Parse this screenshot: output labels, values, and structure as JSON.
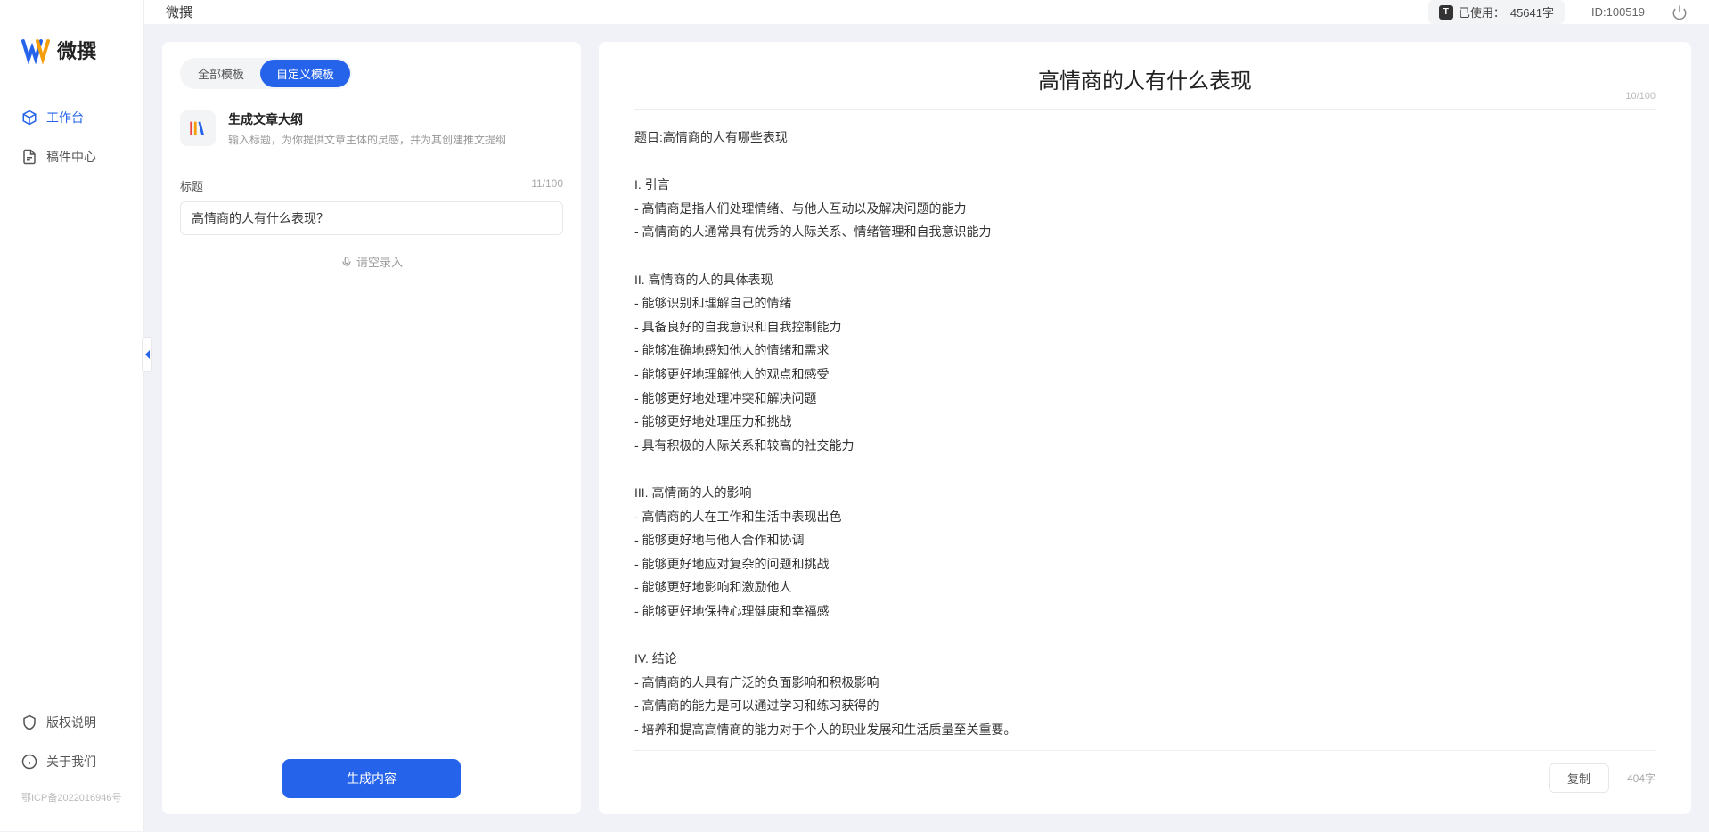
{
  "app": {
    "name": "微撰",
    "logo_text": "微撰"
  },
  "sidebar": {
    "items": [
      {
        "label": "工作台",
        "icon": "cube"
      },
      {
        "label": "稿件中心",
        "icon": "document"
      }
    ],
    "footer": [
      {
        "label": "版权说明",
        "icon": "shield"
      },
      {
        "label": "关于我们",
        "icon": "info"
      }
    ],
    "icp": "鄂ICP备2022016946号"
  },
  "topbar": {
    "usage_prefix": "已使用：",
    "usage_value": "45641字",
    "user_id": "ID:100519"
  },
  "leftPanel": {
    "tabs": [
      {
        "label": "全部模板"
      },
      {
        "label": "自定义模板"
      }
    ],
    "template": {
      "title": "生成文章大纲",
      "desc": "输入标题，为你提供文章主体的灵感，并为其创建推文提纲"
    },
    "titleField": {
      "label": "标题",
      "count": "11/100",
      "value": "高情商的人有什么表现？"
    },
    "voice_label": "请空录入",
    "generate_label": "生成内容"
  },
  "rightPanel": {
    "title": "高情商的人有什么表现",
    "top_count": "10/100",
    "body": "题目:高情商的人有哪些表现\n\nI. 引言\n- 高情商是指人们处理情绪、与他人互动以及解决问题的能力\n- 高情商的人通常具有优秀的人际关系、情绪管理和自我意识能力\n\nII. 高情商的人的具体表现\n- 能够识别和理解自己的情绪\n- 具备良好的自我意识和自我控制能力\n- 能够准确地感知他人的情绪和需求\n- 能够更好地理解他人的观点和感受\n- 能够更好地处理冲突和解决问题\n- 能够更好地处理压力和挑战\n- 具有积极的人际关系和较高的社交能力\n\nIII. 高情商的人的影响\n- 高情商的人在工作和生活中表现出色\n- 能够更好地与他人合作和协调\n- 能够更好地应对复杂的问题和挑战\n- 能够更好地影响和激励他人\n- 能够更好地保持心理健康和幸福感\n\nIV. 结论\n- 高情商的人具有广泛的负面影响和积极影响\n- 高情商的能力是可以通过学习和练习获得的\n- 培养和提高高情商的能力对于个人的职业发展和生活质量至关重要。",
    "copy_label": "复制",
    "word_count": "404字"
  }
}
